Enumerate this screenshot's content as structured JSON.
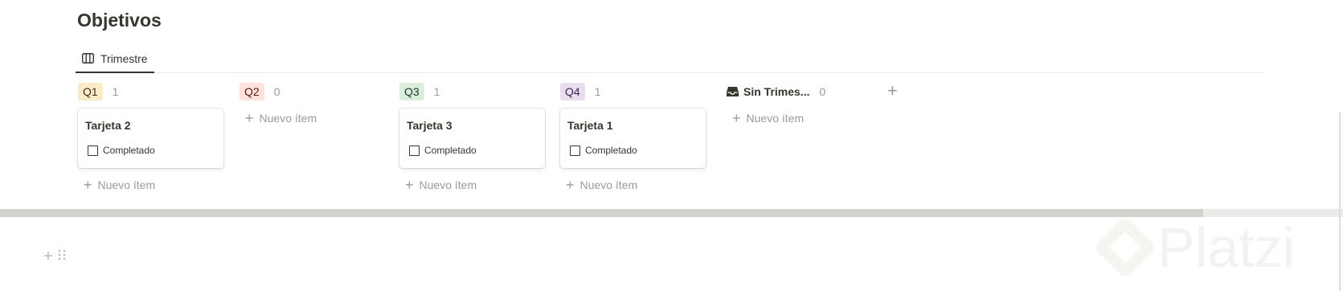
{
  "page": {
    "title": "Objetivos"
  },
  "view_tab": {
    "label": "Trimestre",
    "icon": "board-icon"
  },
  "columns": [
    {
      "label": "Q1",
      "count": "1",
      "badge_bg": "#fbecc8",
      "badge_fg": "#402c1b",
      "cards": [
        {
          "title": "Tarjeta 2",
          "checkbox_label": "Completado"
        }
      ],
      "new_item": "Nuevo ítem"
    },
    {
      "label": "Q2",
      "count": "0",
      "badge_bg": "#ffe2dd",
      "badge_fg": "#5d1715",
      "cards": [],
      "new_item": "Nuevo ítem"
    },
    {
      "label": "Q3",
      "count": "1",
      "badge_bg": "#dbeddb",
      "badge_fg": "#1c3829",
      "cards": [
        {
          "title": "Tarjeta 3",
          "checkbox_label": "Completado"
        }
      ],
      "new_item": "Nuevo ítem"
    },
    {
      "label": "Q4",
      "count": "1",
      "badge_bg": "#e8deee",
      "badge_fg": "#412454",
      "cards": [
        {
          "title": "Tarjeta 1",
          "checkbox_label": "Completado"
        }
      ],
      "new_item": "Nuevo ítem"
    },
    {
      "label": "Sin Trimes...",
      "count": "0",
      "icon": "inbox-icon",
      "cards": [],
      "new_item": "Nuevo ítem"
    }
  ],
  "add_group_label": "+",
  "watermark": {
    "text": "Platzi"
  }
}
